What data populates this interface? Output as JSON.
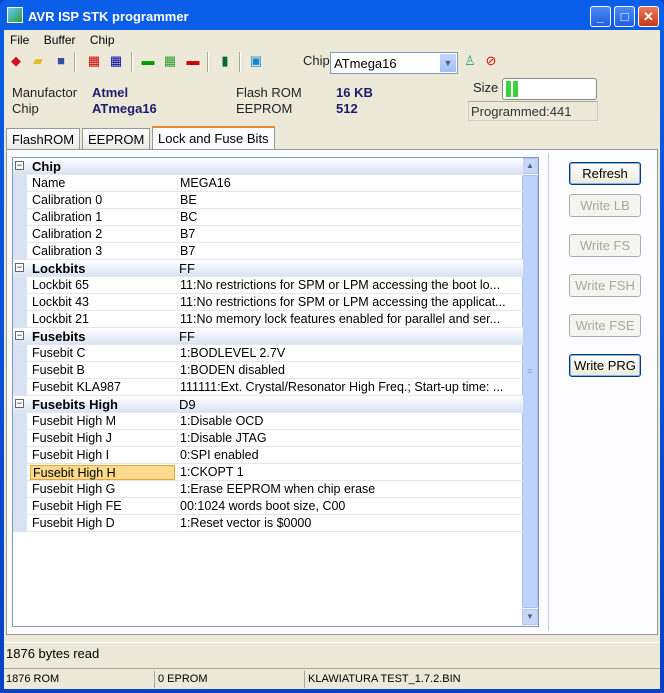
{
  "window": {
    "title": "AVR ISP STK programmer",
    "min": "_",
    "max": "□",
    "close": "✕"
  },
  "menu": [
    "File",
    "Buffer",
    "Chip"
  ],
  "toolbar": {
    "chip_label": "Chip",
    "chip_value": "ATmega16"
  },
  "info": {
    "manufactor_label": "Manufactor",
    "manufactor": "Atmel",
    "chip_label": "Chip",
    "chip": "ATmega16",
    "flash_label": "Flash ROM",
    "flash": "16 KB",
    "eeprom_label": "EEPROM",
    "eeprom": "512",
    "size_label": "Size",
    "size_progress": 0.1,
    "programmed": "Programmed:441"
  },
  "tabs": [
    "FlashROM",
    "EEPROM",
    "Lock and Fuse Bits"
  ],
  "rows": [
    {
      "t": "cat",
      "n": "Chip",
      "v": ""
    },
    {
      "n": "Name",
      "v": "MEGA16"
    },
    {
      "n": "Calibration 0",
      "v": "BE"
    },
    {
      "n": "Calibration 1",
      "v": "BC"
    },
    {
      "n": "Calibration 2",
      "v": "B7"
    },
    {
      "n": "Calibration 3",
      "v": "B7"
    },
    {
      "t": "cat",
      "n": "Lockbits",
      "v": "FF"
    },
    {
      "n": "Lockbit 65",
      "v": "11:No restrictions for SPM or LPM accessing the boot lo..."
    },
    {
      "n": "Lockbit 43",
      "v": "11:No restrictions for SPM or LPM accessing the applicat..."
    },
    {
      "n": "Lockbit 21",
      "v": "11:No memory lock features enabled for parallel and ser..."
    },
    {
      "t": "cat",
      "n": "Fusebits",
      "v": "FF"
    },
    {
      "n": "Fusebit C",
      "v": "1:BODLEVEL 2.7V"
    },
    {
      "n": "Fusebit B",
      "v": "1:BODEN disabled"
    },
    {
      "n": "Fusebit KLA987",
      "v": "111111:Ext. Crystal/Resonator High Freq.; Start-up time: ..."
    },
    {
      "t": "cat",
      "n": "Fusebits High",
      "v": "D9"
    },
    {
      "n": "Fusebit High M",
      "v": "1:Disable OCD"
    },
    {
      "n": "Fusebit High J",
      "v": "1:Disable JTAG"
    },
    {
      "n": "Fusebit High I",
      "v": "0:SPI enabled"
    },
    {
      "t": "sel",
      "n": "Fusebit High H",
      "v": "1:CKOPT 1"
    },
    {
      "n": "Fusebit High G",
      "v": "1:Erase EEPROM when chip erase"
    },
    {
      "n": "Fusebit High FE",
      "v": "00:1024 words boot size, C00"
    },
    {
      "n": "Fusebit High D",
      "v": "1:Reset vector is $0000"
    }
  ],
  "buttons": [
    {
      "label": "Refresh",
      "enabled": true
    },
    {
      "label": "Write LB",
      "enabled": false
    },
    {
      "label": "Write FS",
      "enabled": false
    },
    {
      "label": "Write FSH",
      "enabled": false
    },
    {
      "label": "Write FSE",
      "enabled": false
    },
    {
      "label": "Write PRG",
      "enabled": true
    }
  ],
  "status": {
    "message": "1876 bytes read",
    "rom": "1876 ROM",
    "eprom": "0 EPROM",
    "file": "KLAWIATURA TEST_1.7.2.BIN"
  }
}
